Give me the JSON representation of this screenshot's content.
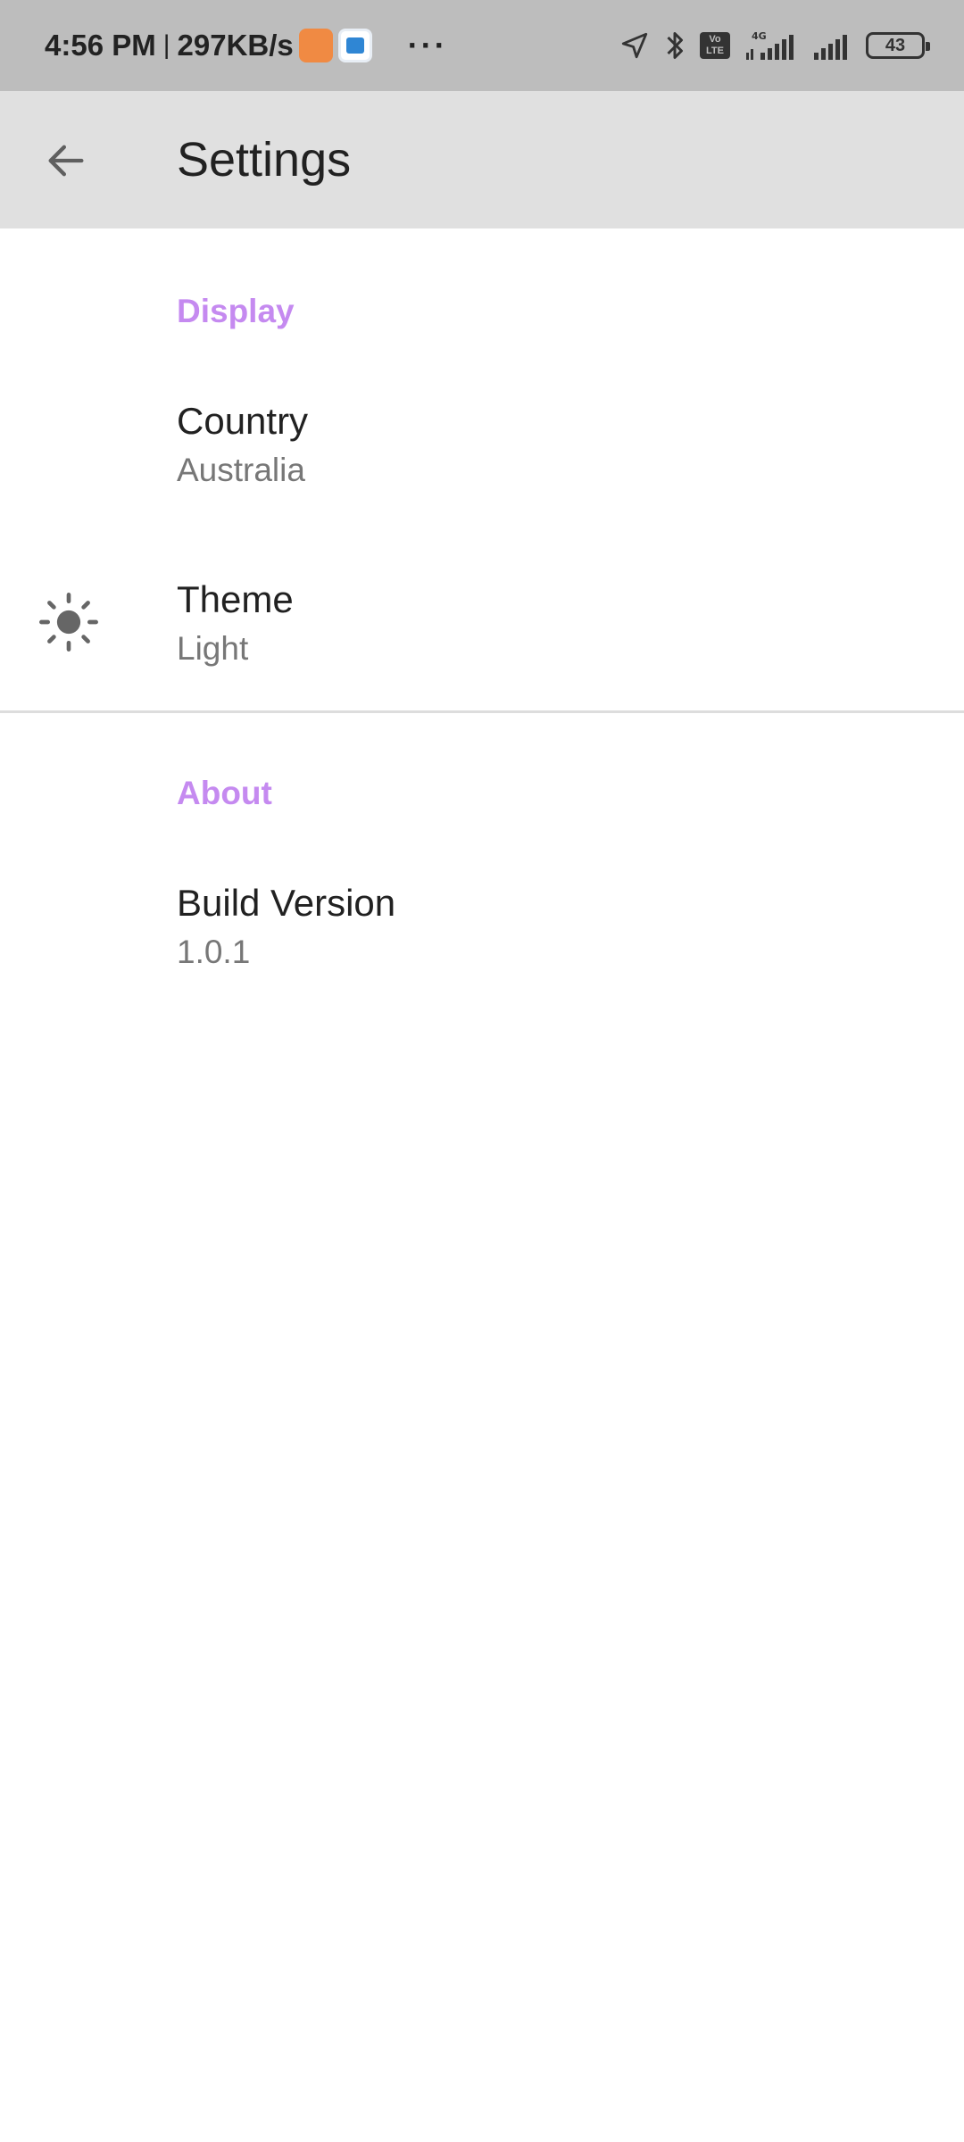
{
  "status_bar": {
    "time": "4:56 PM",
    "separator": "|",
    "speed": "297KB/s",
    "dots": "···",
    "volte": "Vo LTE",
    "battery": "43"
  },
  "app_bar": {
    "title": "Settings",
    "back_icon": "arrow-back-icon"
  },
  "sections": [
    {
      "header": "Display",
      "items": [
        {
          "title": "Country",
          "summary": "Australia",
          "icon": null
        },
        {
          "title": "Theme",
          "summary": "Light",
          "icon": "brightness-icon"
        }
      ]
    },
    {
      "header": "About",
      "items": [
        {
          "title": "Build Version",
          "summary": "1.0.1",
          "icon": null
        }
      ]
    }
  ],
  "colors": {
    "accent": "#c58af0",
    "app_bar": "#e0e0e0",
    "status_bar": "#bdbdbd"
  }
}
